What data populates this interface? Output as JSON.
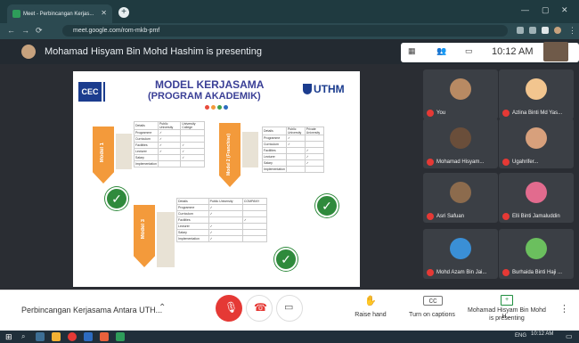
{
  "browser": {
    "tab_title": "Meet - Perbincangan Kerjas...",
    "url": "meet.google.com/rom-mkb-pmf"
  },
  "header": {
    "presenter_text": "Mohamad Hisyam Bin Mohd Hashim is presenting",
    "time": "10:12 AM"
  },
  "slide": {
    "title": "MODEL KERJASAMA",
    "subtitle": "(PROGRAM AKADEMIK)",
    "uthm": "UTHM",
    "cec": "CEC",
    "model1_label": "Model 1",
    "model2_label": "Model 2 (Franchise)",
    "model3_label": "Model 3",
    "rows": [
      "Programme",
      "Curriculum",
      "Facilities",
      "Lecturer",
      "Salary",
      "Implementation"
    ],
    "model1_cols": [
      "Details",
      "Public University",
      "University College"
    ],
    "model2_cols": [
      "Details",
      "Public University",
      "Private University"
    ],
    "model3_cols": [
      "Details",
      "Public University",
      "COMPANY"
    ]
  },
  "participants": [
    {
      "name": "You",
      "color": "#b88a63"
    },
    {
      "name": "Azlina Binti Md Yas...",
      "color": "#f2c58f"
    },
    {
      "name": "Mohamad Hisyam...",
      "color": "#6a4e3a"
    },
    {
      "name": "Ugahrifer...",
      "color": "#d7a07c"
    },
    {
      "name": "Asri Safuan",
      "color": "#8c6b4d"
    },
    {
      "name": "Elli Binti Jamaluddin",
      "color": "#e26b8e"
    },
    {
      "name": "Mohd Azam Bin Jai...",
      "color": "#3a8fd6"
    },
    {
      "name": "Burhaida Binti Haji ...",
      "color": "#6bbf5e"
    }
  ],
  "bottom": {
    "meeting_name": "Perbincangan Kerjasama Antara UTH...",
    "raise_hand": "Raise hand",
    "captions": "Turn on captions",
    "presenting_line1": "Mohamad Hisyam Bin Mohd H...",
    "presenting_line2": "is presenting"
  },
  "taskbar": {
    "time": "10:12 AM",
    "lang": "ENG"
  }
}
